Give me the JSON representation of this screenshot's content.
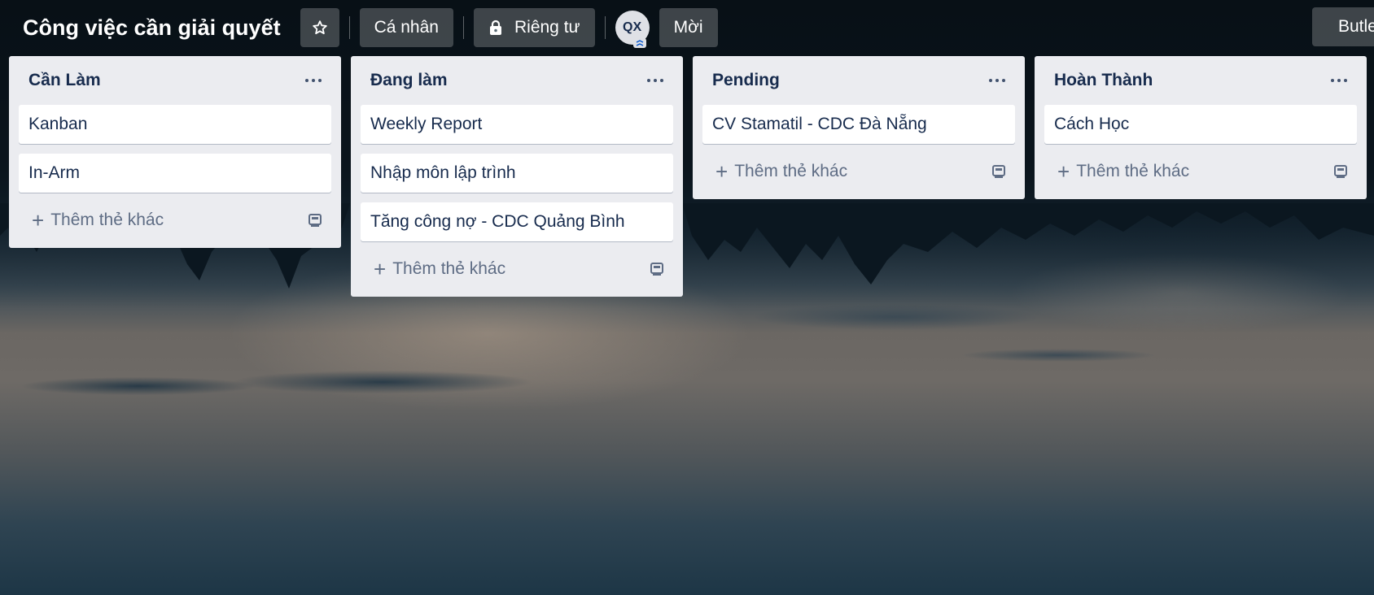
{
  "board": {
    "title": "Công việc cần giải quyết",
    "visibility_workspace": "Cá nhân",
    "visibility_privacy": "Riêng tư",
    "member_initials": "QX",
    "invite_label": "Mời",
    "butler_label": "Butler"
  },
  "lists": [
    {
      "title": "Cần Làm",
      "cards": [
        "Kanban",
        "In-Arm"
      ],
      "add_card_label": "Thêm thẻ khác"
    },
    {
      "title": "Đang làm",
      "cards": [
        "Weekly Report",
        "Nhập môn lập trình",
        "Tăng công nợ - CDC Quảng Bình"
      ],
      "add_card_label": "Thêm thẻ khác"
    },
    {
      "title": "Pending",
      "cards": [
        "CV Stamatil - CDC Đà Nẵng"
      ],
      "add_card_label": "Thêm thẻ khác"
    },
    {
      "title": "Hoàn Thành",
      "cards": [
        "Cách Học"
      ],
      "add_card_label": "Thêm thẻ khác"
    }
  ],
  "icons": {
    "star": "star-icon",
    "lock": "lock-icon",
    "more": "more-horizontal-icon",
    "plus": "plus-icon",
    "template": "card-template-icon",
    "butler": "butler-bell-icon"
  }
}
